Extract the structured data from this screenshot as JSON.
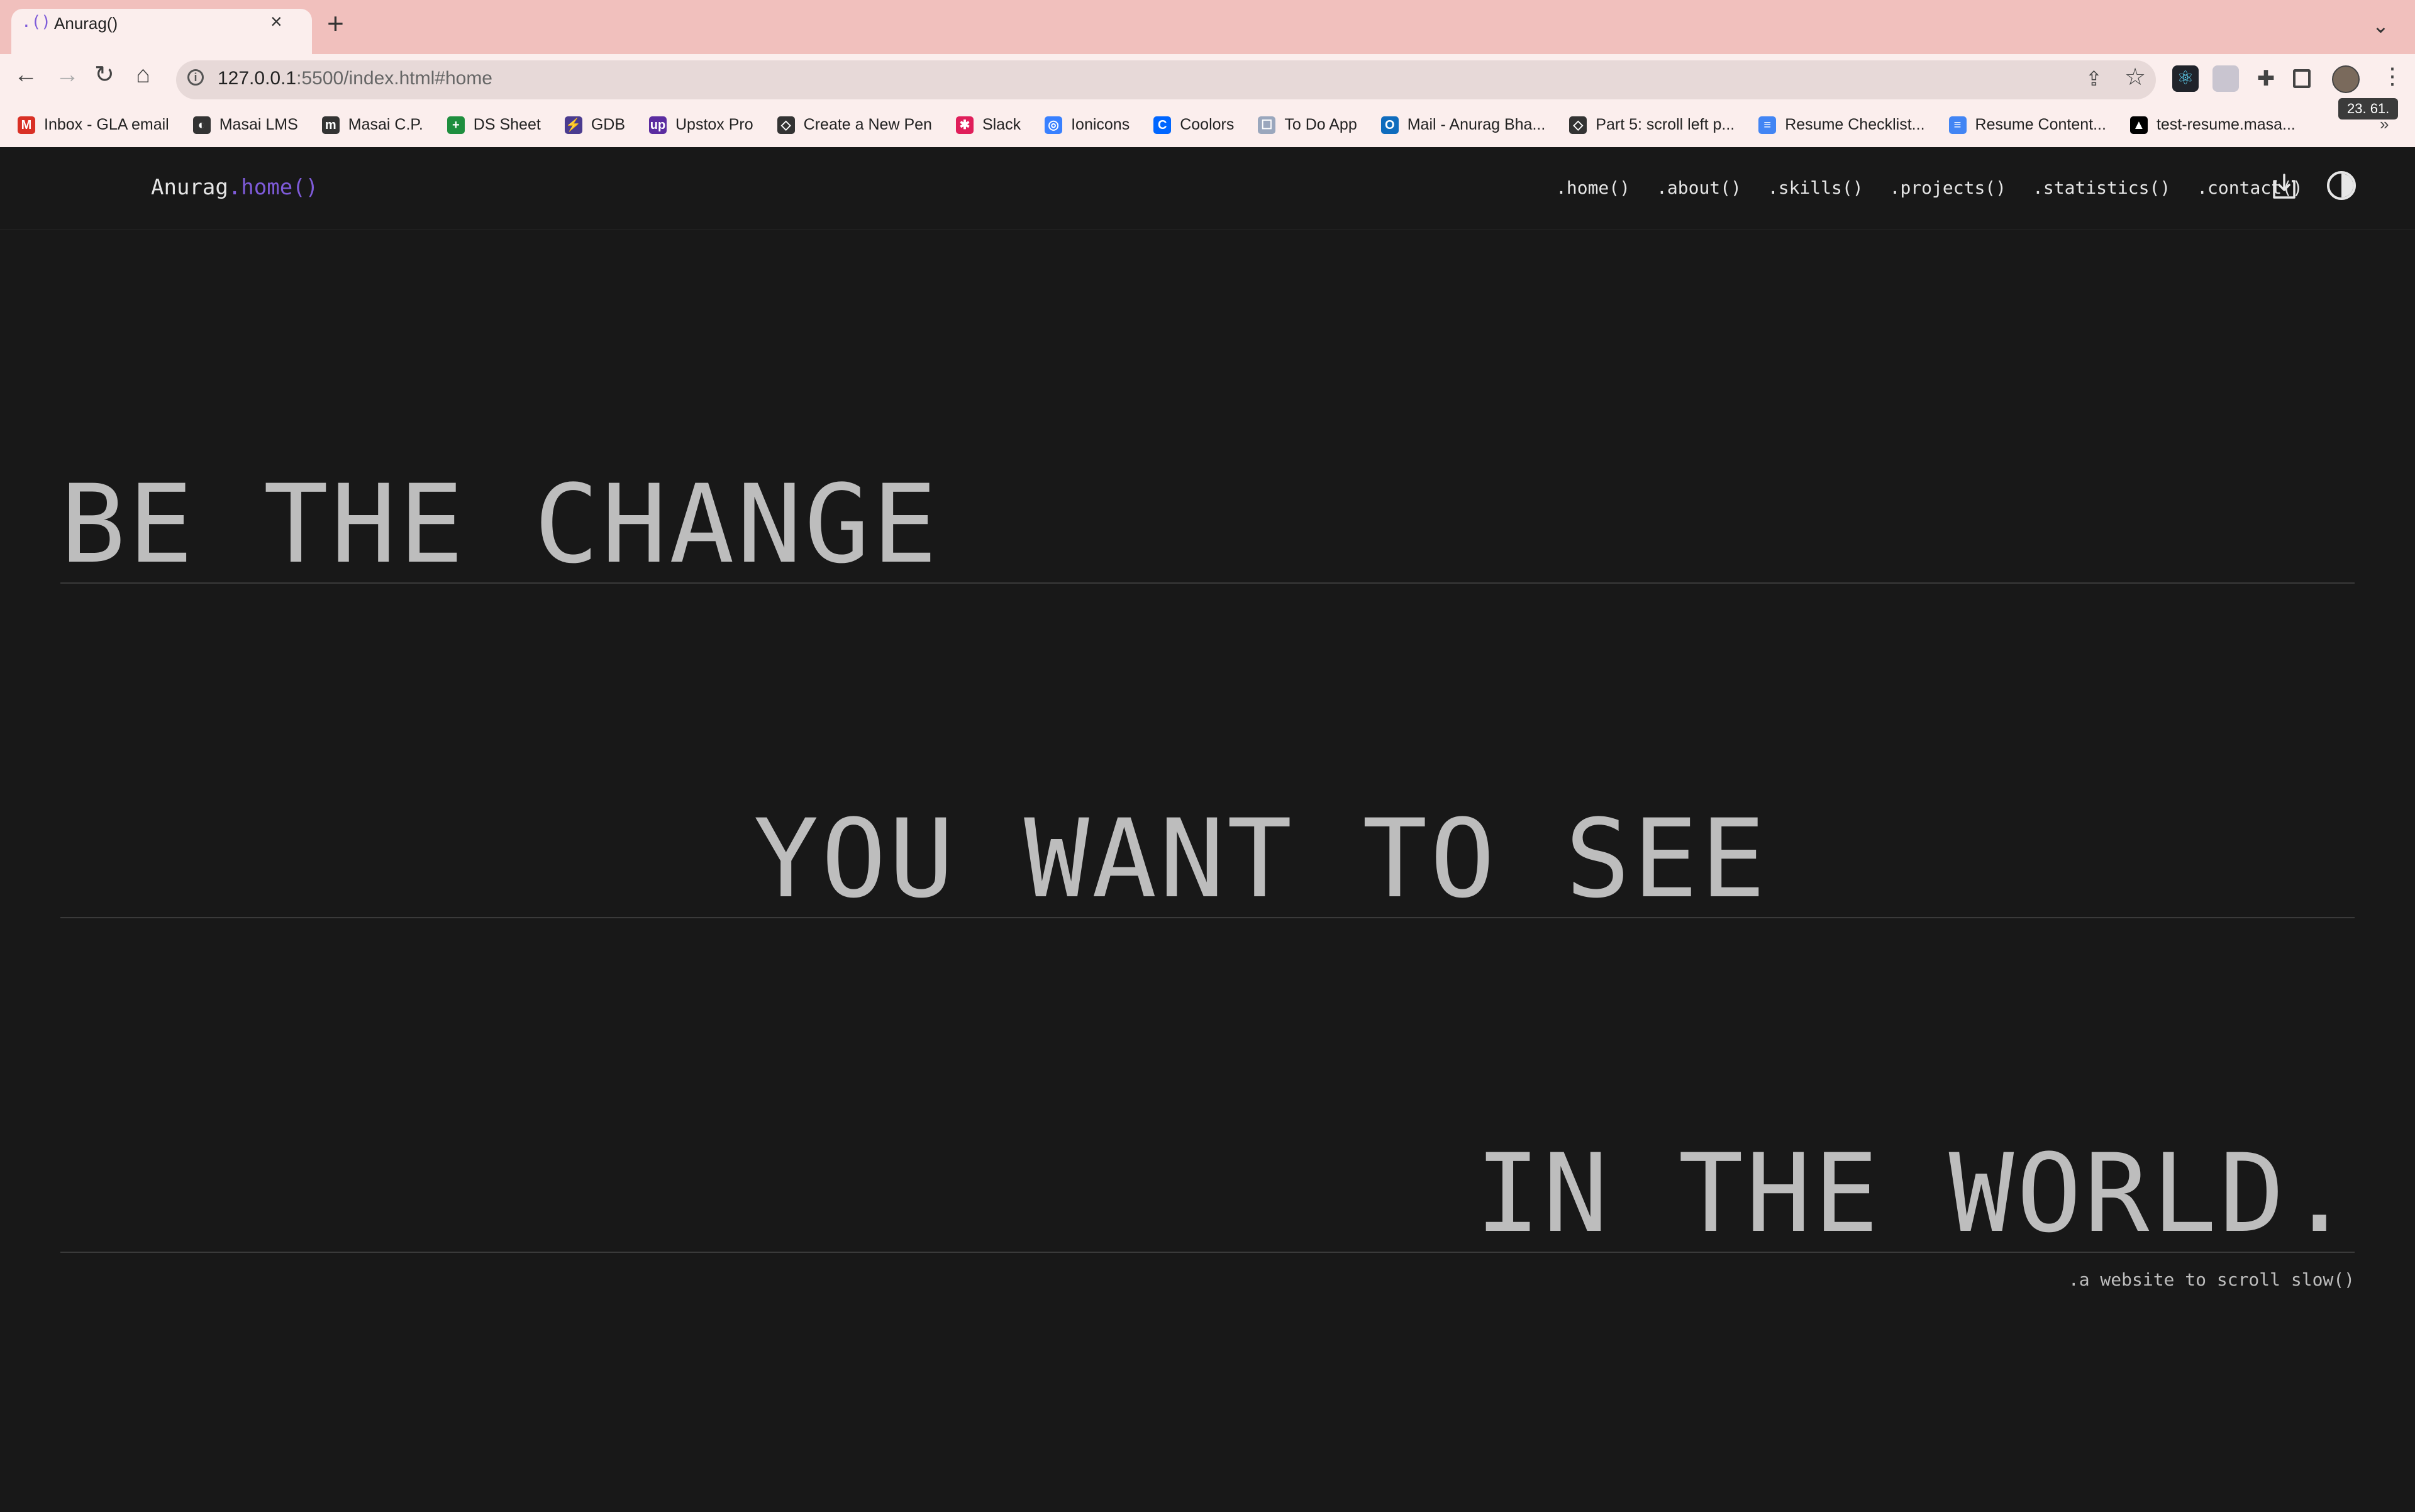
{
  "browser": {
    "tab": {
      "favicon": ".()",
      "title": "Anurag()",
      "close": "×"
    },
    "new_tab": "+",
    "tab_menu": "⌄",
    "nav": {
      "back": "←",
      "forward": "→",
      "reload": "↻",
      "home": "⌂"
    },
    "url": {
      "host": "127.0.0.1",
      "rest": ":5500/index.html#home"
    },
    "tooltip": "23. 61.",
    "bookmarks": [
      {
        "label": "Inbox - GLA email",
        "icon": "M",
        "color": "#d93025"
      },
      {
        "label": "Masai LMS",
        "icon": "◐",
        "color": "#333333"
      },
      {
        "label": "Masai C.P.",
        "icon": "m",
        "color": "#333333"
      },
      {
        "label": "DS Sheet",
        "icon": "+",
        "color": "#1e8e3e"
      },
      {
        "label": "GDB",
        "icon": "⚡",
        "color": "#4a3b8f"
      },
      {
        "label": "Upstox Pro",
        "icon": "up",
        "color": "#5b2ca0"
      },
      {
        "label": "Create a New Pen",
        "icon": "◇",
        "color": "#333333"
      },
      {
        "label": "Slack",
        "icon": "✱",
        "color": "#e01e5a"
      },
      {
        "label": "Ionicons",
        "icon": "◎",
        "color": "#3880ff"
      },
      {
        "label": "Coolors",
        "icon": "C",
        "color": "#0066ff"
      },
      {
        "label": "To Do App",
        "icon": "☐",
        "color": "#9aa7bd"
      },
      {
        "label": "Mail - Anurag Bha...",
        "icon": "O",
        "color": "#0f6cbd"
      },
      {
        "label": "Part 5: scroll left p...",
        "icon": "◇",
        "color": "#333333"
      },
      {
        "label": "Resume Checklist...",
        "icon": "≡",
        "color": "#4285f4"
      },
      {
        "label": "Resume Content...",
        "icon": "≡",
        "color": "#4285f4"
      },
      {
        "label": "test-resume.masa...",
        "icon": "▲",
        "color": "#000000"
      }
    ],
    "bookmarks_more": "»"
  },
  "site": {
    "brand": {
      "name": "Anurag",
      "accent": ".home()"
    },
    "nav": [
      ".home()",
      ".about()",
      ".skills()",
      ".projects()",
      ".statistics()",
      ".contact()"
    ],
    "hero": {
      "line1": "BE THE CHANGE",
      "line2": "YOU WANT TO SEE",
      "line3": "IN THE WORLD.",
      "caption": ".a website to scroll slow()"
    }
  }
}
